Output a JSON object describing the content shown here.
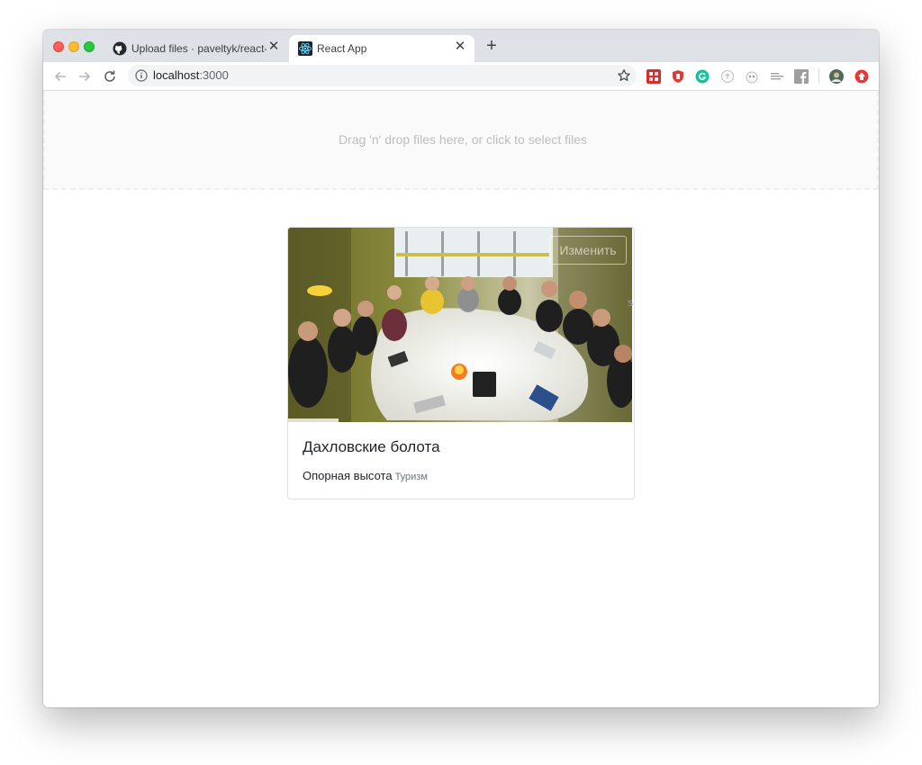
{
  "browser": {
    "tabs": [
      {
        "title": "Upload files · paveltyk/react-tag",
        "active": false,
        "icon": "github-icon"
      },
      {
        "title": "React App",
        "active": true,
        "icon": "react-icon"
      }
    ],
    "close_glyph": "✕",
    "new_tab_glyph": "+",
    "address": {
      "host": "localhost",
      "port": ":3000"
    },
    "extensions": [
      "extension-red-grid-icon",
      "extension-shield-icon",
      "grammarly-icon",
      "extension-circle-icon",
      "extension-ghost-icon",
      "extension-text-icon",
      "facebook-icon",
      "profile-avatar",
      "extension-red-icon"
    ]
  },
  "dropzone": {
    "text": "Drag 'n' drop files here, or click to select files"
  },
  "card": {
    "edit_label": "Изменить",
    "stray_text": "s",
    "title": "Дахловские болота",
    "subtitle": "Опорная высота",
    "tag": "Туризм"
  },
  "colors": {
    "accent": "#dee1e6",
    "dropzone_bg": "#fafafa",
    "muted_text": "#bdbdbd"
  }
}
